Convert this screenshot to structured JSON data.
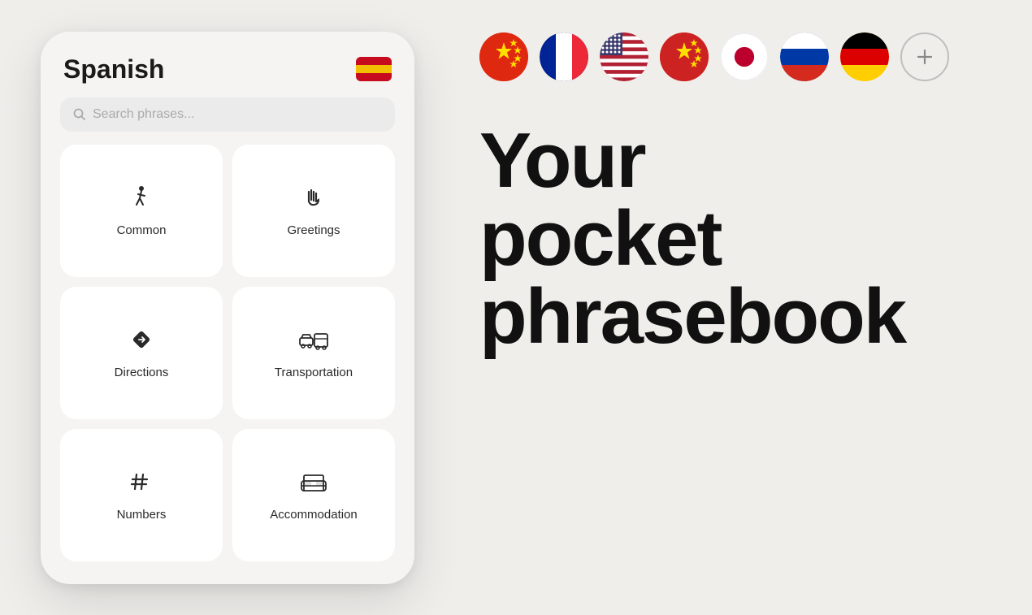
{
  "phone": {
    "title": "Spanish",
    "search_placeholder": "Search phrases...",
    "categories": [
      {
        "id": "common",
        "label": "Common",
        "icon": "walk"
      },
      {
        "id": "greetings",
        "label": "Greetings",
        "icon": "wave"
      },
      {
        "id": "directions",
        "label": "Directions",
        "icon": "direction"
      },
      {
        "id": "transportation",
        "label": "Transportation",
        "icon": "transport"
      },
      {
        "id": "numbers",
        "label": "Numbers",
        "icon": "hash"
      },
      {
        "id": "accommodation",
        "label": "Accommodation",
        "icon": "bed"
      }
    ]
  },
  "flags": [
    {
      "id": "chinese",
      "title": "Chinese"
    },
    {
      "id": "french",
      "title": "French"
    },
    {
      "id": "american",
      "title": "American English"
    },
    {
      "id": "chinese2",
      "title": "Mandarin Chinese"
    },
    {
      "id": "japanese",
      "title": "Japanese"
    },
    {
      "id": "russian",
      "title": "Russian"
    },
    {
      "id": "german",
      "title": "German"
    }
  ],
  "headline": {
    "line1": "Your",
    "line2": "pocket",
    "line3": "phrasebook"
  },
  "add_language_label": "+"
}
